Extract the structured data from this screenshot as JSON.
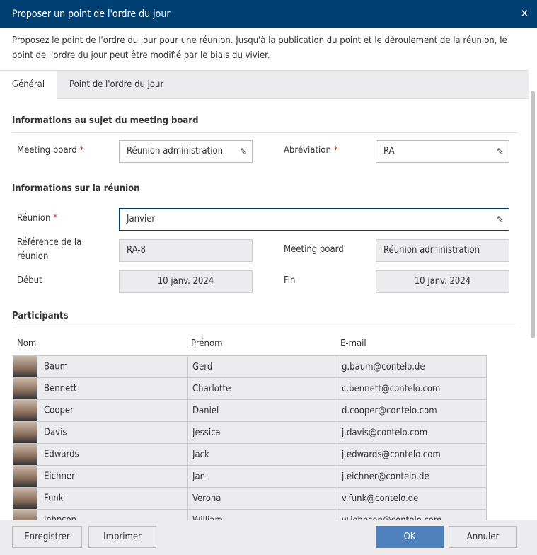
{
  "title": "Proposer un point de l'ordre du jour",
  "close_icon": "close-icon",
  "description": "Proposez le point de l'ordre du jour pour une réunion. Jusqu'à la publication du point et le déroulement de la réunion, le point de l'ordre du jour peut être modifié par le biais du vivier.",
  "tabs": [
    {
      "label": "Général",
      "active": true
    },
    {
      "label": "Point de l'ordre du jour",
      "active": false
    }
  ],
  "board_section": {
    "title": "Informations au sujet du meeting board",
    "board_label": "Meeting board",
    "board_value": "Réunion administration",
    "abbr_label": "Abréviation",
    "abbr_value": "RA",
    "required": "*"
  },
  "meeting_section": {
    "title": "Informations sur la réunion",
    "meeting_label": "Réunion",
    "meeting_value": "Janvier",
    "ref_label": "Référence de la réunion",
    "ref_value": "RA-8",
    "board_label": "Meeting board",
    "board_value": "Réunion administration",
    "start_label": "Début",
    "start_value": "10 janv. 2024",
    "end_label": "Fin",
    "end_value": "10 janv. 2024"
  },
  "participants": {
    "title": "Participants",
    "columns": [
      "Nom",
      "Prénom",
      "E-mail"
    ],
    "rows": [
      {
        "last": "Baum",
        "first": "Gerd",
        "email": "g.baum@contelo.de"
      },
      {
        "last": "Bennett",
        "first": "Charlotte",
        "email": "c.bennett@contelo.com"
      },
      {
        "last": "Cooper",
        "first": "Daniel",
        "email": "d.cooper@contelo.com"
      },
      {
        "last": "Davis",
        "first": "Jessica",
        "email": "j.davis@contelo.com"
      },
      {
        "last": "Edwards",
        "first": "Jack",
        "email": "j.edwards@contelo.com"
      },
      {
        "last": "Eichner",
        "first": "Jan",
        "email": "j.eichner@contelo.de"
      },
      {
        "last": "Funk",
        "first": "Verona",
        "email": "v.funk@contelo.de"
      },
      {
        "last": "Johnson",
        "first": "William",
        "email": "w.johnson@contelo.com"
      }
    ]
  },
  "footer": {
    "save": "Enregistrer",
    "print": "Imprimer",
    "ok": "OK",
    "cancel": "Annuler"
  },
  "colors": {
    "titlebar": "#003f72",
    "primary_button": "#4f81bd"
  }
}
